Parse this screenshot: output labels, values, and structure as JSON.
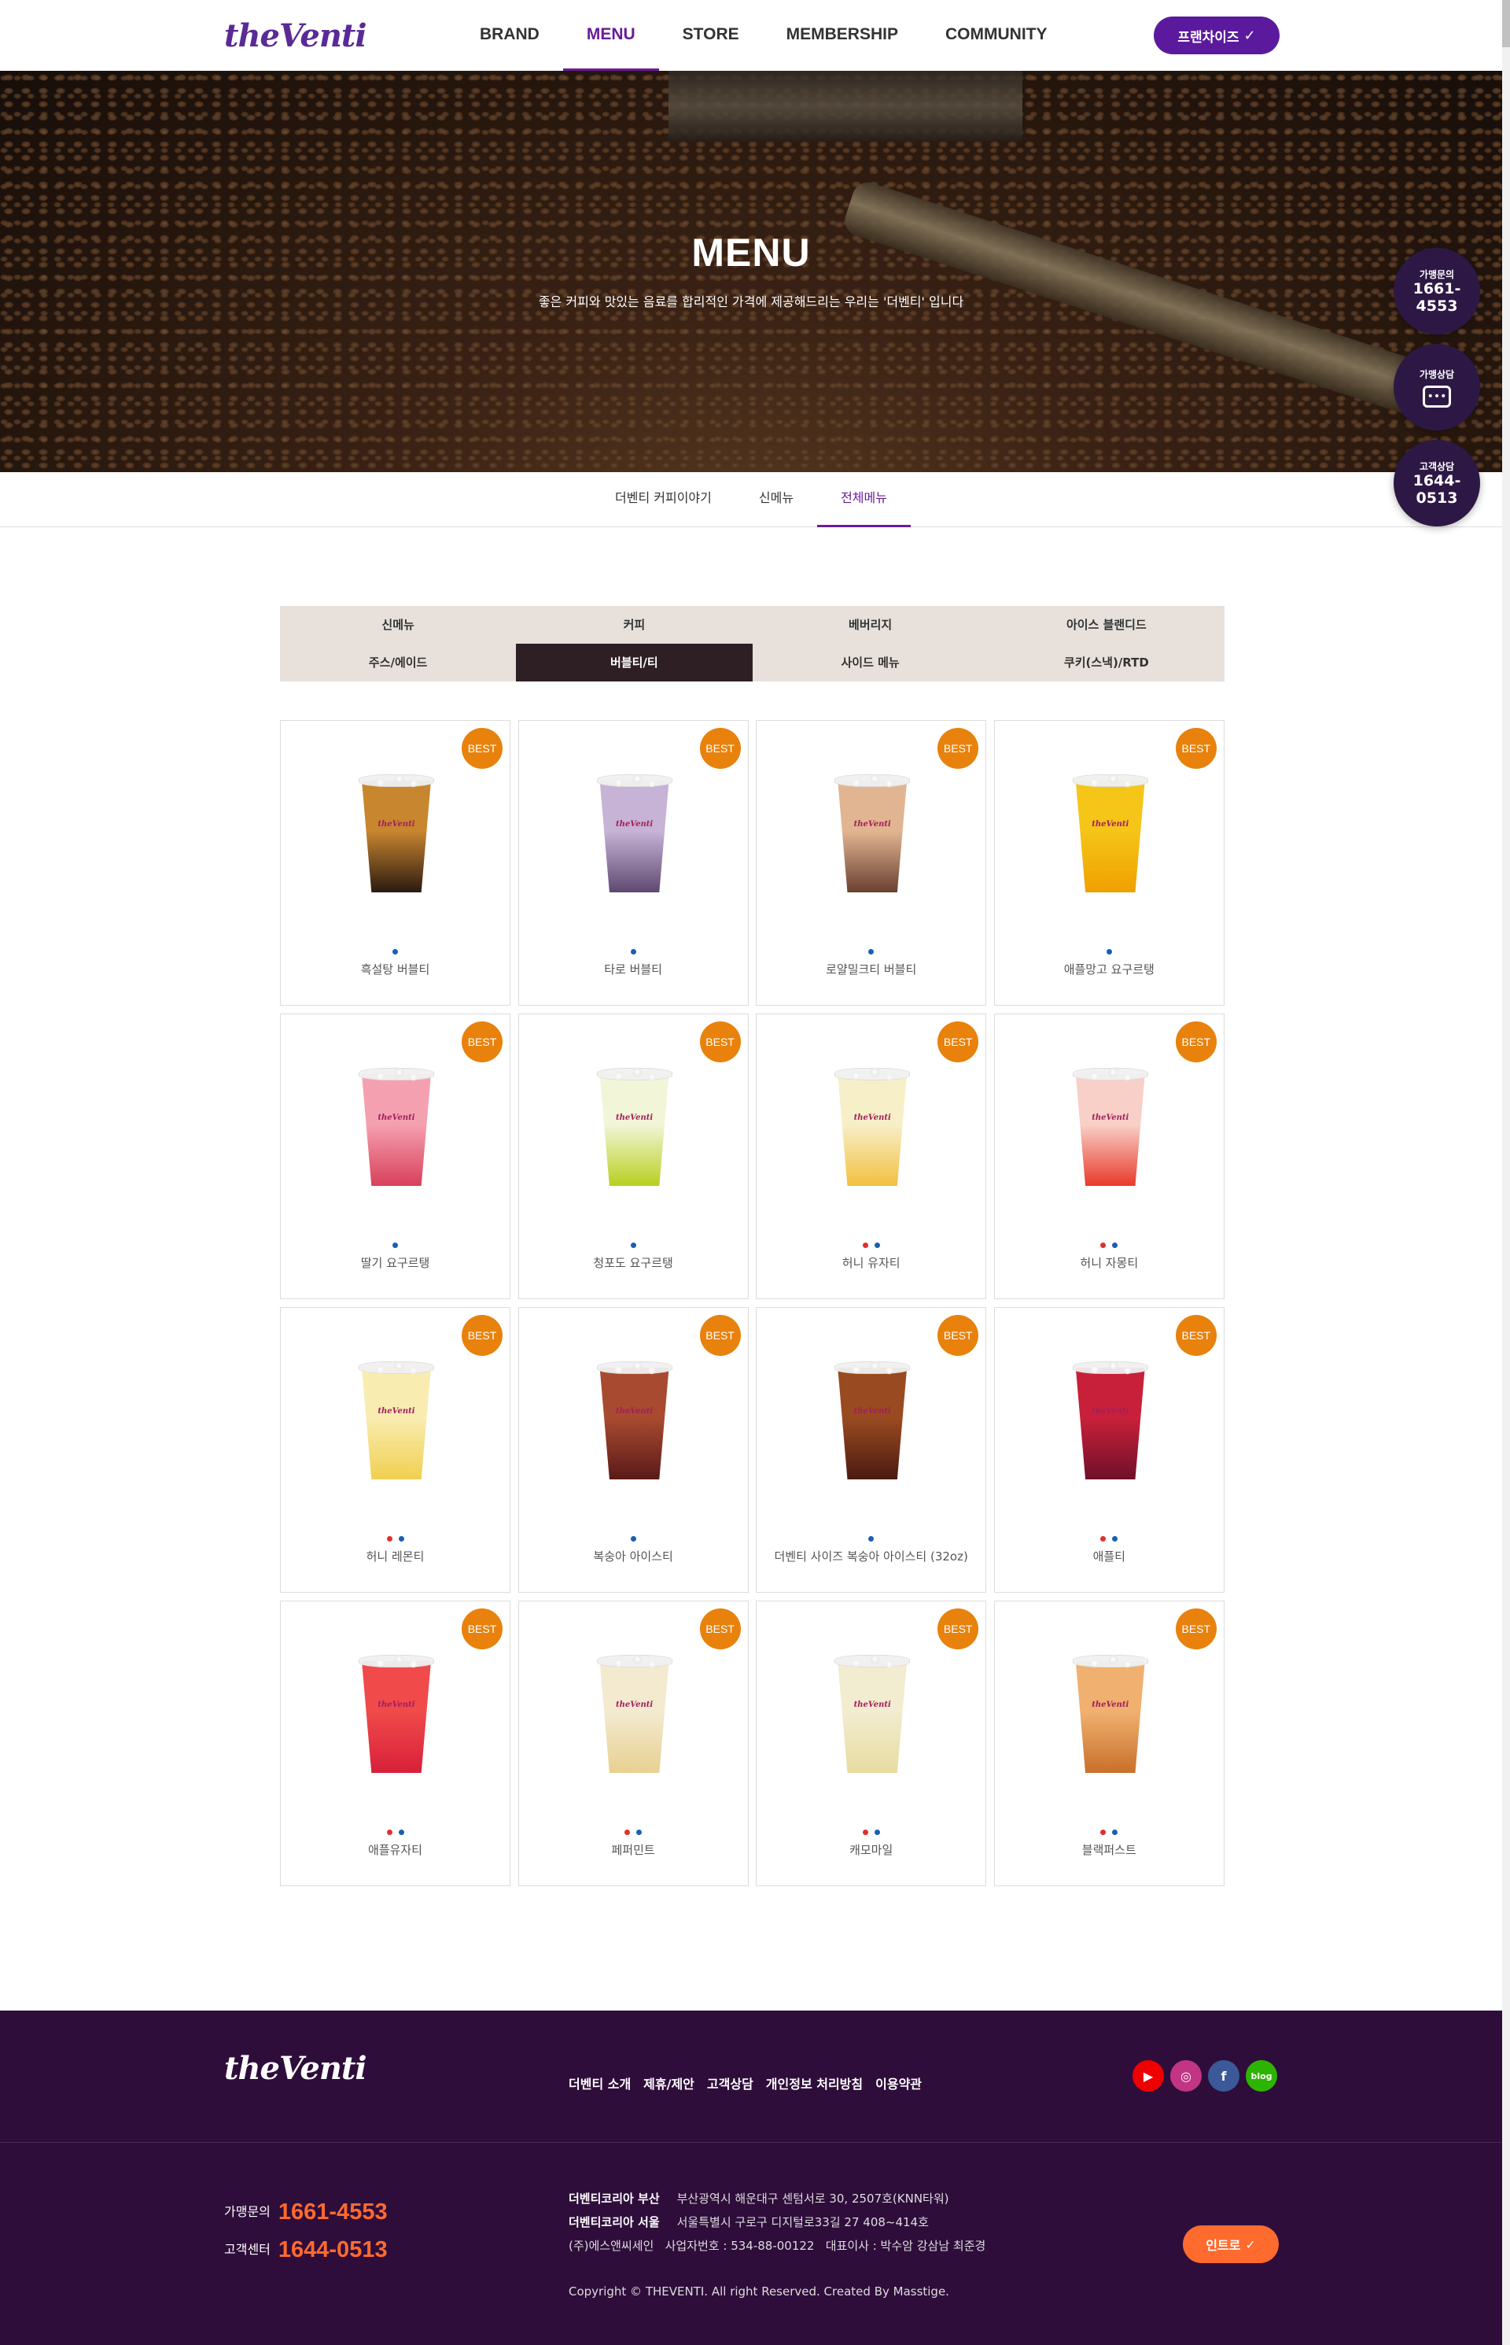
{
  "header": {
    "logo": "theVenti",
    "nav": [
      {
        "label": "BRAND"
      },
      {
        "label": "MENU"
      },
      {
        "label": "STORE"
      },
      {
        "label": "MEMBERSHIP"
      },
      {
        "label": "COMMUNITY"
      }
    ],
    "franchise_btn": "프랜차이즈"
  },
  "hero": {
    "title": "MENU",
    "subtitle": "좋은 커피와 맛있는 음료를 합리적인 가격에 제공해드리는 우리는 '더벤티' 입니다"
  },
  "subnav": [
    {
      "label": "더벤티 커피이야기"
    },
    {
      "label": "신메뉴"
    },
    {
      "label": "전체메뉴"
    }
  ],
  "floating": {
    "franchise_inquiry": {
      "title": "가맹문의",
      "num1": "1661-",
      "num2": "4553"
    },
    "consult": {
      "title": "가맹상담"
    },
    "customer": {
      "title": "고객상담",
      "num1": "1644-",
      "num2": "0513"
    }
  },
  "categories": {
    "row1": [
      "신메뉴",
      "커피",
      "베버리지",
      "아이스 블랜디드"
    ],
    "row2": [
      "주스/에이드",
      "버블티/티",
      "사이드 메뉴",
      "쿠키(스낵)/RTD"
    ],
    "active": "버블티/티"
  },
  "best_label": "BEST",
  "products": [
    {
      "name": "흑설탕 버블티",
      "dots": [
        "blue"
      ],
      "color": "#c8862f",
      "color2": "#2a1a10"
    },
    {
      "name": "타로 버블티",
      "dots": [
        "blue"
      ],
      "color": "#c7b3d6",
      "color2": "#5e4a70"
    },
    {
      "name": "로얄밀크티 버블티",
      "dots": [
        "blue"
      ],
      "color": "#e2b592",
      "color2": "#6a4030"
    },
    {
      "name": "애플망고 요구르탱",
      "dots": [
        "blue"
      ],
      "color": "#f5c518",
      "color2": "#f0a000"
    },
    {
      "name": "딸기 요구르탱",
      "dots": [
        "blue"
      ],
      "color": "#f5a0b0",
      "color2": "#d8405a"
    },
    {
      "name": "청포도 요구르탱",
      "dots": [
        "blue"
      ],
      "color": "#f2f5d8",
      "color2": "#b8d020"
    },
    {
      "name": "허니 유자티",
      "dots": [
        "red",
        "blue"
      ],
      "color": "#f7efc8",
      "color2": "#f2c040"
    },
    {
      "name": "허니 자몽티",
      "dots": [
        "red",
        "blue"
      ],
      "color": "#f8d0c8",
      "color2": "#e83a2a"
    },
    {
      "name": "허니 레몬티",
      "dots": [
        "red",
        "blue"
      ],
      "color": "#f9ecb0",
      "color2": "#f0d050"
    },
    {
      "name": "복숭아 아이스티",
      "dots": [
        "blue"
      ],
      "color": "#a84a30",
      "color2": "#5a1a18"
    },
    {
      "name": "더벤티 사이즈 복숭아 아이스티 (32oz)",
      "dots": [
        "blue"
      ],
      "color": "#9a4a20",
      "color2": "#4a1a10"
    },
    {
      "name": "애플티",
      "dots": [
        "red",
        "blue"
      ],
      "color": "#c8203a",
      "color2": "#70102a"
    },
    {
      "name": "애플유자티",
      "dots": [
        "red",
        "blue"
      ],
      "color": "#f04a4a",
      "color2": "#d8203a"
    },
    {
      "name": "페퍼민트",
      "dots": [
        "red",
        "blue"
      ],
      "color": "#f3ead0",
      "color2": "#e8d090"
    },
    {
      "name": "캐모마일",
      "dots": [
        "red",
        "blue"
      ],
      "color": "#f2ecd0",
      "color2": "#e8dca0"
    },
    {
      "name": "블랙퍼스트",
      "dots": [
        "red",
        "blue"
      ],
      "color": "#f0b070",
      "color2": "#c8702a"
    }
  ],
  "footer": {
    "logo": "theVenti",
    "links": [
      "더벤티 소개",
      "제휴/제안",
      "고객상담",
      "개인정보 처리방침",
      "이용약관"
    ],
    "sns": [
      {
        "icon": "youtube-icon",
        "color": "#e00"
      },
      {
        "icon": "instagram-icon",
        "color": "#c13584"
      },
      {
        "icon": "facebook-icon",
        "color": "#3b5998"
      },
      {
        "icon": "blog-icon",
        "color": "#2db400"
      }
    ],
    "franchise": {
      "label": "가맹문의",
      "num": "1661-4553"
    },
    "customer": {
      "label": "고객센터",
      "num": "1644-0513"
    },
    "busan": {
      "label": "더벤티코리아 부산",
      "addr": "부산광역시 해운대구 센텀서로 30, 2507호(KNN타워)"
    },
    "seoul": {
      "label": "더벤티코리아 서울",
      "addr": "서울특별시 구로구 디지털로33길 27 408~414호"
    },
    "company": "(주)에스앤씨세인   사업자번호 : 534-88-00122   대표이사 : 박수암 강삼남 최준경",
    "copyright": "Copyright © THEVENTI. All right Reserved. Created By Masstige.",
    "intro_btn": "인트로"
  }
}
